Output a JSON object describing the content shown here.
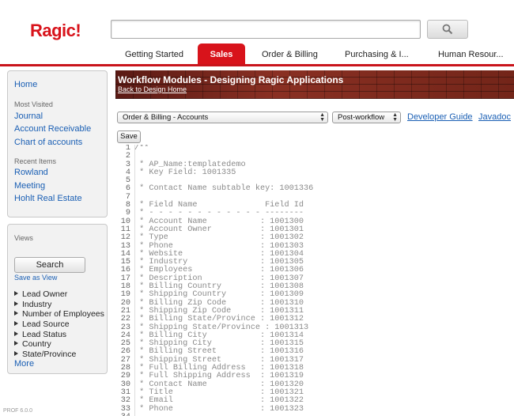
{
  "app": {
    "logo": "Ragic!",
    "version": "PROF 6.0.0"
  },
  "header": {
    "search": {
      "value": "",
      "placeholder": ""
    }
  },
  "tabs": [
    {
      "label": "Getting Started",
      "active": false
    },
    {
      "label": "Sales",
      "active": true
    },
    {
      "label": "Order & Billing",
      "active": false
    },
    {
      "label": "Purchasing & I...",
      "active": false
    },
    {
      "label": "Human Resour...",
      "active": false
    }
  ],
  "sidebar": {
    "home": "Home",
    "most_visited_title": "Most Visited",
    "most_visited": [
      "Journal",
      "Account Receivable",
      "Chart of accounts"
    ],
    "recent_title": "Recent Items",
    "recent": [
      "Rowland",
      "Meeting",
      "Hohlt Real Estate"
    ],
    "views_title": "Views",
    "search_button": "Search",
    "save_as_view": "Save as View",
    "filters": [
      "Lead Owner",
      "Industry",
      "Number of Employees",
      "Lead Source",
      "Lead Status",
      "Country",
      "State/Province"
    ],
    "more": "More"
  },
  "banner": {
    "title": "Workflow Modules - Designing Ragic Applications",
    "back_link": "Back to Design Home"
  },
  "toolbar": {
    "sheet_select": "Order & Billing - Accounts",
    "workflow_select": "Post-workflow",
    "developer_guide": "Developer Guide",
    "javadoc": "Javadoc",
    "save": "Save"
  },
  "code_lines": [
    "/**",
    "",
    " * AP_Name:templatedemo",
    " * Key Field: 1001335",
    "",
    " * Contact Name subtable key: 1001336",
    "",
    " * Field Name              Field Id",
    " * - - - - - - - - - - - - --------",
    " * Account Name           : 1001300",
    " * Account Owner          : 1001301",
    " * Type                   : 1001302",
    " * Phone                  : 1001303",
    " * Website                : 1001304",
    " * Industry               : 1001305",
    " * Employees              : 1001306",
    " * Description            : 1001307",
    " * Billing Country        : 1001308",
    " * Shipping Country       : 1001309",
    " * Billing Zip Code       : 1001310",
    " * Shipping Zip Code      : 1001311",
    " * Billing State/Province : 1001312",
    " * Shipping State/Province : 1001313",
    " * Billing City           : 1001314",
    " * Shipping City          : 1001315",
    " * Billing Street         : 1001316",
    " * Shipping Street        : 1001317",
    " * Full Billing Address   : 1001318",
    " * Full Shipping Address  : 1001319",
    " * Contact Name           : 1001320",
    " * Title                  : 1001321",
    " * Email                  : 1001322",
    " * Phone                  : 1001323",
    "",
    ""
  ]
}
